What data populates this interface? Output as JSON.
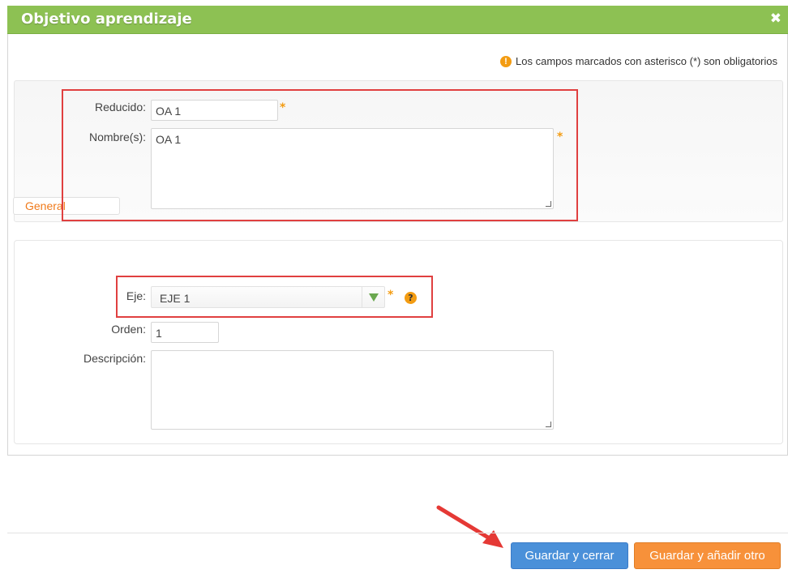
{
  "window": {
    "title": "Objetivo aprendizaje",
    "close_glyph": "✖"
  },
  "notice": {
    "icon": "!",
    "text": "Los campos marcados con asterisco (*) son obligatorios"
  },
  "form": {
    "reducido": {
      "label": "Reducido:",
      "value": "OA 1",
      "required_mark": "*"
    },
    "nombres": {
      "label": "Nombre(s):",
      "value": "OA 1",
      "required_mark": "*"
    }
  },
  "general": {
    "legend": "General",
    "eje": {
      "label": "Eje:",
      "value": "EJE 1",
      "required_mark": "*",
      "help_icon": "?"
    },
    "orden": {
      "label": "Orden:",
      "value": "1"
    },
    "descripcion": {
      "label": "Descripción:",
      "value": ""
    }
  },
  "buttons": {
    "save_close": "Guardar y cerrar",
    "save_add": "Guardar y añadir otro"
  },
  "colors": {
    "titlebar": "#8dc153",
    "highlight_box": "#e04040",
    "save_close_button": "#4a90d9",
    "save_add_button": "#f7913a",
    "legend_text": "#f07a1a"
  }
}
